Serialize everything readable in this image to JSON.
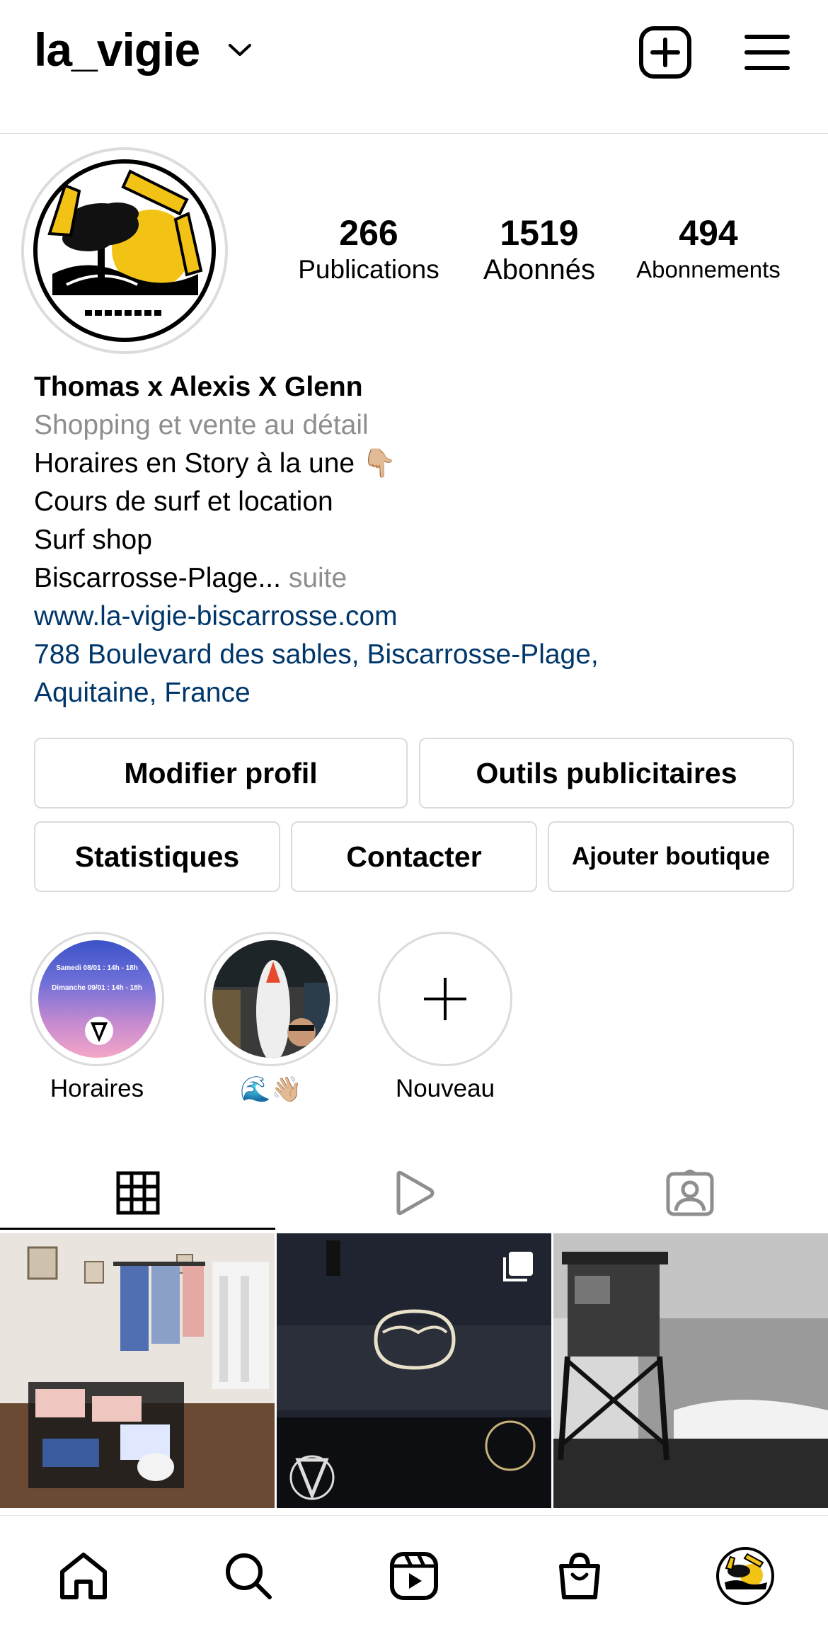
{
  "header": {
    "username": "la_vigie"
  },
  "profile": {
    "avatar_logo_text": "La Vigie Surf Shop Biscarrosse",
    "stats": [
      {
        "value": "266",
        "label": "Publications"
      },
      {
        "value": "1519",
        "label": "Abonnés"
      },
      {
        "value": "494",
        "label": "Abonnements"
      }
    ]
  },
  "bio": {
    "name": "Thomas x Alexis X Glenn",
    "category": "Shopping et vente au détail",
    "line1": "Horaires en Story à la une 👇🏼",
    "line2": "Cours de surf et location",
    "line3": "Surf shop",
    "line4": "Biscarrosse-Plage...",
    "more": "suite",
    "website": "www.la-vigie-biscarrosse.com",
    "address1": "788 Boulevard des sables, Biscarrosse-Plage,",
    "address2": "Aquitaine, France"
  },
  "buttons": {
    "edit_profile": "Modifier profil",
    "ad_tools": "Outils publicitaires",
    "insights": "Statistiques",
    "contact": "Contacter",
    "add_shop": "Ajouter boutique"
  },
  "highlights": [
    {
      "label": "Horaires",
      "thumb_line1": "Samedi 08/01 : 14h - 18h",
      "thumb_line2": "Dimanche 09/01 : 14h - 18h"
    },
    {
      "label": "🌊👋🏼"
    },
    {
      "label": "Nouveau"
    }
  ],
  "tabs": [
    "grid",
    "reels",
    "tagged"
  ],
  "colors": {
    "link": "#00376b",
    "secondary_text": "#8e8e8e",
    "border": "#dbdbdb"
  },
  "icons": {
    "top_right": [
      "new-post-icon",
      "menu-icon"
    ],
    "bottom_nav": [
      "home-icon",
      "search-icon",
      "reels-icon",
      "shop-icon",
      "profile-avatar"
    ]
  }
}
